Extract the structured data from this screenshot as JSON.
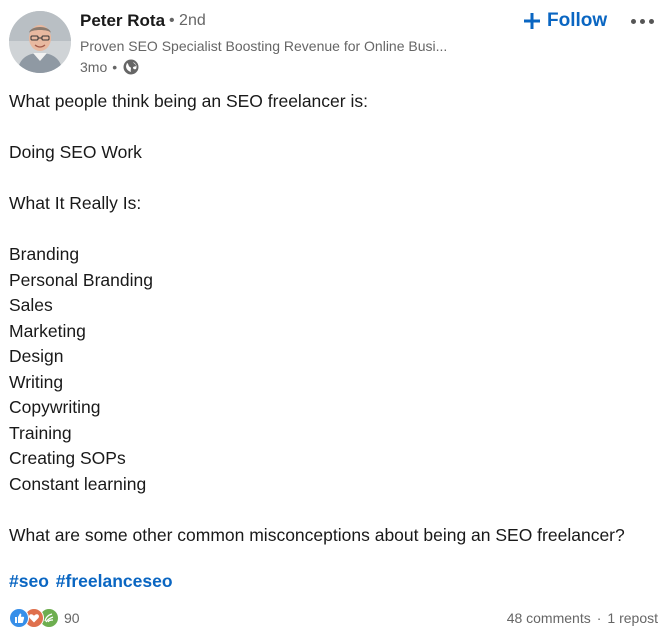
{
  "author": {
    "name": "Peter Rota",
    "degree": "• 2nd",
    "headline": "Proven SEO Specialist Boosting Revenue for Online Busi...",
    "time": "3mo",
    "meta_separator": "•"
  },
  "actions": {
    "follow_label": "Follow"
  },
  "post": {
    "intro": "What people think being an SEO freelancer is:",
    "perception": "Doing SEO Work",
    "reality_heading": "What It Really Is:",
    "reality_items": [
      "Branding",
      "Personal Branding",
      "Sales",
      "Marketing",
      "Design",
      "Writing",
      "Copywriting",
      "Training",
      "Creating SOPs",
      "Constant learning"
    ],
    "question": "What are some other common misconceptions about being an SEO freelancer?",
    "hashtags": [
      "#seo",
      "#freelanceseo"
    ]
  },
  "social": {
    "reaction_count": "90",
    "comments": "48 comments",
    "separator": "·",
    "reposts": "1 repost",
    "reaction_icons": [
      "like-icon",
      "love-icon",
      "support-icon"
    ]
  },
  "colors": {
    "link_blue": "#0a66c2",
    "secondary_text": "#666666",
    "like_blue": "#378fe9",
    "love_red": "#df704d",
    "support_green": "#6dae4f"
  }
}
